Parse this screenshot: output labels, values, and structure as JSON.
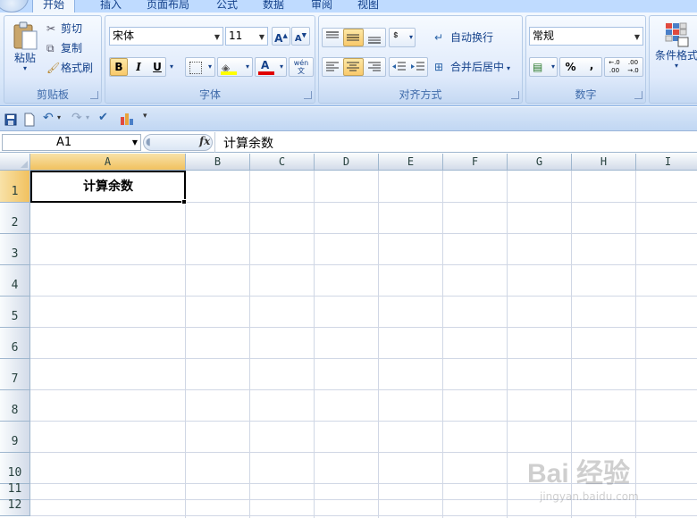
{
  "tabs": [
    "开始",
    "插入",
    "页面布局",
    "公式",
    "数据",
    "审阅",
    "视图"
  ],
  "ribbon": {
    "clipboard": {
      "label": "剪贴板",
      "paste": "粘贴",
      "cut": "剪切",
      "copy": "复制",
      "format_painter": "格式刷"
    },
    "font": {
      "label": "字体",
      "font_name": "宋体",
      "font_size": "11",
      "bold": "B",
      "italic": "I",
      "underline": "U",
      "font_color_glyph": "A",
      "phonetic_glyph": "wén\n文"
    },
    "alignment": {
      "label": "对齐方式",
      "wrap_text": "自动换行",
      "merge_center": "合并后居中"
    },
    "number": {
      "label": "数字",
      "format": "常规",
      "percent": "%",
      "comma": ",",
      "inc_decimal": "←.0\n.00",
      "dec_decimal": ".00\n→.0"
    },
    "styles": {
      "conditional_format": "条件格式"
    }
  },
  "formula_bar": {
    "name_box": "A1",
    "fx": "fx",
    "formula": "计算余数"
  },
  "grid": {
    "columns": [
      "A",
      "B",
      "C",
      "D",
      "E",
      "F",
      "G",
      "H",
      "I"
    ],
    "rows": [
      "1",
      "2",
      "3",
      "4",
      "5",
      "6",
      "7",
      "8",
      "9",
      "10",
      "11",
      "12"
    ],
    "selected_cell": "A1",
    "cells": {
      "A1": "计算余数"
    }
  },
  "watermark": {
    "brand": "Bai 经验",
    "url": "jingyan.baidu.com"
  },
  "colors": {
    "ribbon_text": "#15428b",
    "selected_header": "#f1c15f",
    "grid_line": "#d0d7e5"
  }
}
